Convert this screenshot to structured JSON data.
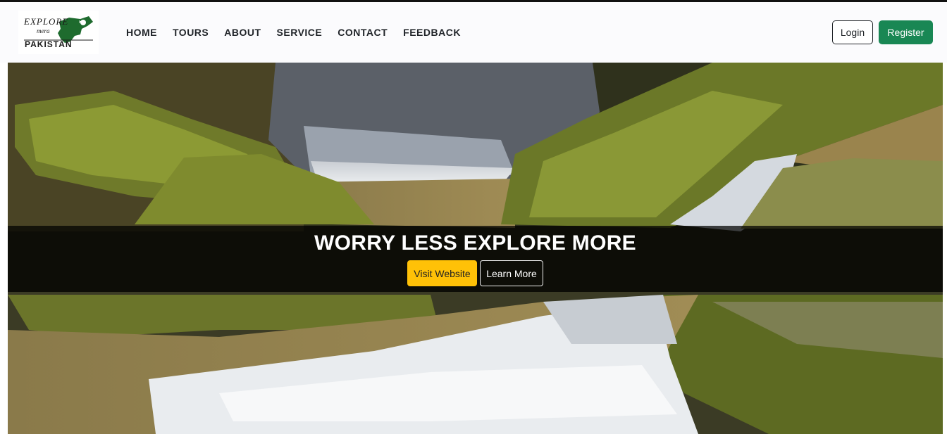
{
  "brand": {
    "logo_lines": [
      "EXPLORE",
      "mera",
      "PAKISTAN"
    ],
    "logo_colors": {
      "map": "#1e6b2e",
      "text": "#1a1a1a"
    }
  },
  "nav": {
    "items": [
      {
        "label": "HOME"
      },
      {
        "label": "TOURS"
      },
      {
        "label": "ABOUT"
      },
      {
        "label": "SERVICE"
      },
      {
        "label": "CONTACT"
      },
      {
        "label": "FEEDBACK"
      }
    ]
  },
  "auth": {
    "login_label": "Login",
    "register_label": "Register"
  },
  "hero": {
    "title": "WORRY LESS EXPLORE MORE",
    "visit_label": "Visit Website",
    "learn_label": "Learn More",
    "background": "mossy-rocks-waterfall-stream-photo"
  },
  "colors": {
    "register_bg": "#198754",
    "visit_bg": "#ffc107",
    "caption_band": "rgba(0,0,0,0.72)"
  }
}
